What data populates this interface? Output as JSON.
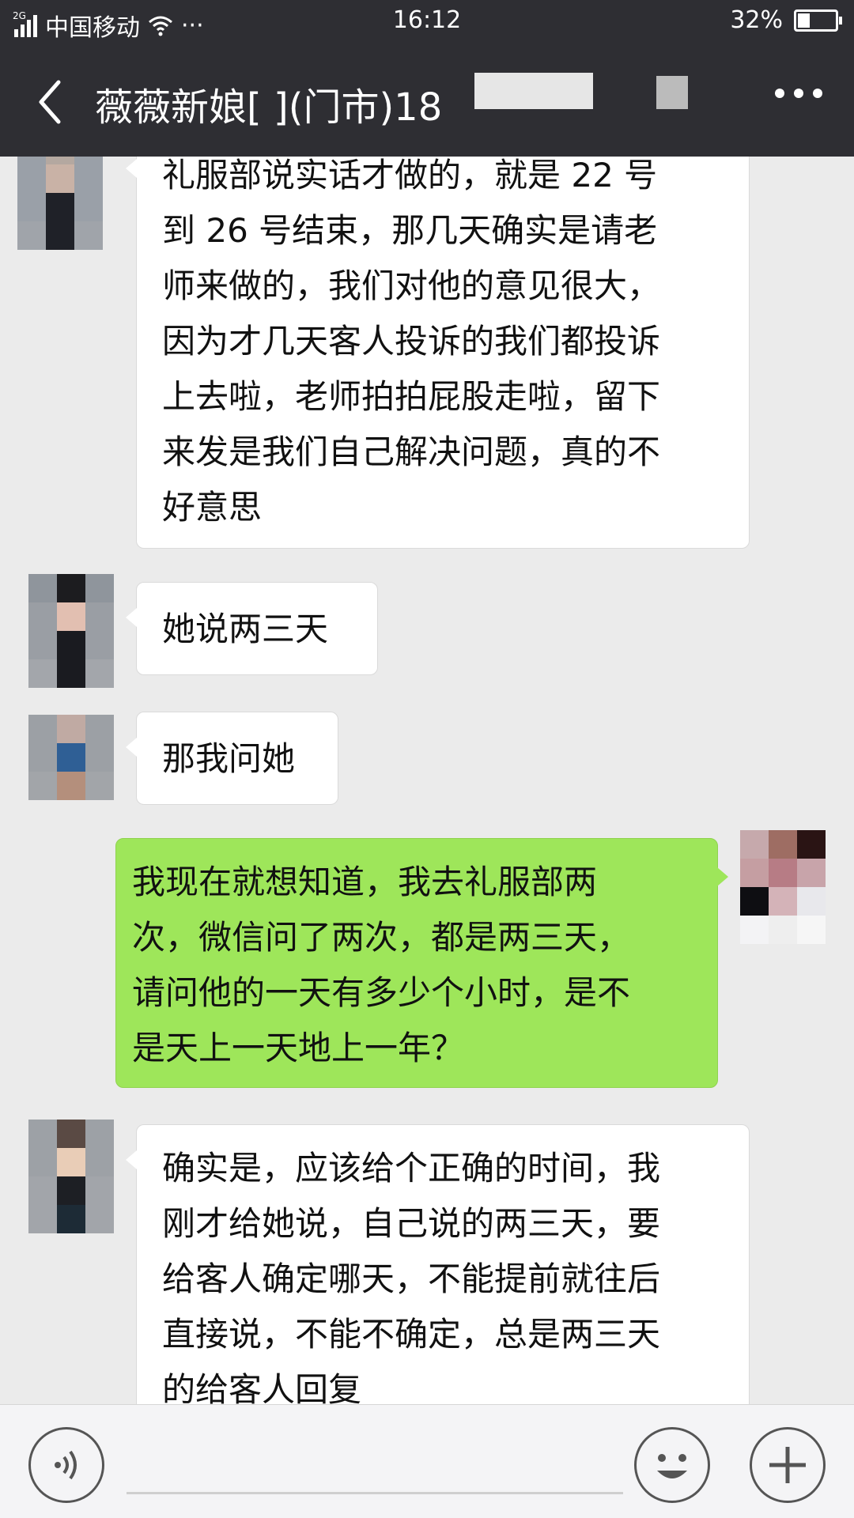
{
  "status_bar": {
    "network": "2G",
    "carrier": "中国移动",
    "extra": "···",
    "time": "16:12",
    "battery": "32%",
    "battery_level": 0.32
  },
  "header": {
    "title": "薇薇新娘[  ](门市)18"
  },
  "messages": [
    {
      "direction": "in",
      "lines": [
        "礼服部说实话才做的，就是 22 号",
        "到 26 号结束，那几天确实是请老",
        "师来做的，我们对他的意见很大，",
        "因为才几天客人投诉的我们都投诉",
        "上去啦，老师拍拍屁股走啦，留下",
        "来发是我们自己解决问题，真的不",
        "好意思"
      ]
    },
    {
      "direction": "in",
      "lines": [
        "她说两三天"
      ]
    },
    {
      "direction": "in",
      "lines": [
        "那我问她"
      ]
    },
    {
      "direction": "out",
      "lines": [
        "我现在就想知道，我去礼服部两",
        "次，微信问了两次，都是两三天，",
        "请问他的一天有多少个小时，是不",
        "是天上一天地上一年？"
      ]
    },
    {
      "direction": "in",
      "lines": [
        "确实是，应该给个正确的时间，我",
        "刚才给她说，自己说的两三天，要",
        "给客人确定哪天，不能提前就往后",
        "直接说，不能不确定，总是两三天",
        "的给客人回复"
      ]
    }
  ],
  "icons": {
    "back": "chevron-left-icon",
    "more": "more-dots-icon",
    "voice": "voice-input-icon",
    "emoji": "emoji-icon",
    "plus": "plus-icon"
  },
  "colors": {
    "bar": "#2e2e33",
    "chat_bg": "#ebebeb",
    "outgoing_bubble": "#9ee65a",
    "incoming_bubble": "#ffffff"
  }
}
